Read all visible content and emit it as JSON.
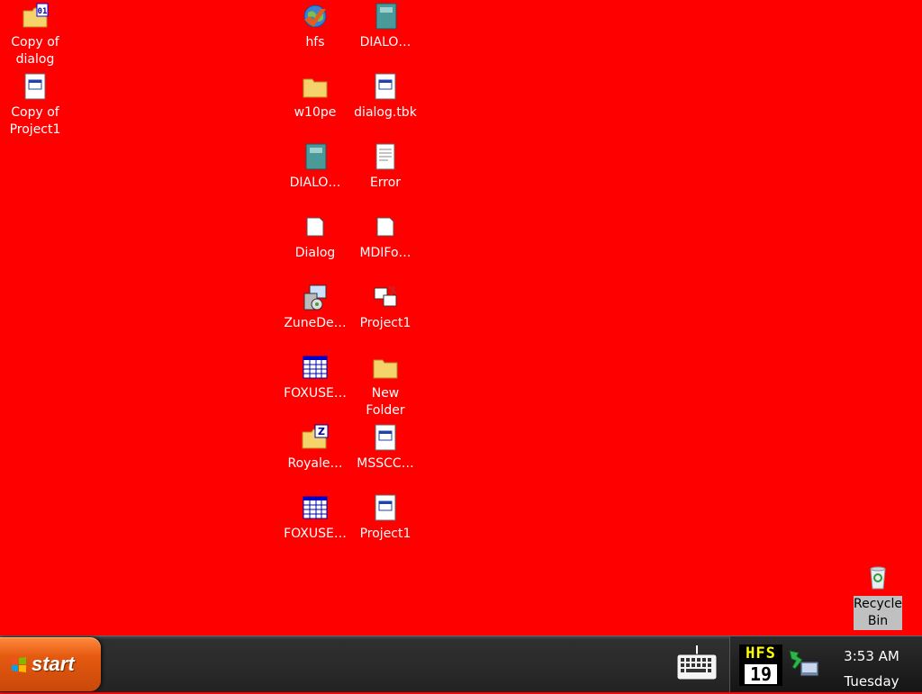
{
  "desktop": {
    "icons": {
      "copy_of_dialog": "Copy of dialog",
      "copy_of_project1": "Copy of Project1",
      "hfs": "hfs",
      "dialo1": "DIALO…",
      "w10pe": "w10pe",
      "dialog_tbk": "dialog.tbk",
      "dialo2": "DIALO…",
      "error": "Error",
      "dialog": "Dialog",
      "mdifo": "MDIFo…",
      "zunede": "ZuneDe…",
      "project1_a": "Project1",
      "foxuse1": "FOXUSE…",
      "new_folder": "New Folder",
      "royale": "Royale…",
      "msscc": "MSSCC…",
      "foxuse2": "FOXUSE…",
      "project1_b": "Project1",
      "recycle_bin": "Recycle Bin"
    },
    "background_color": "#ff0000"
  },
  "taskbar": {
    "start_label": "start",
    "tray": {
      "hfs_top": "HFS",
      "hfs_bottom": "19",
      "time": "3:53 AM",
      "day": "Tuesday"
    }
  }
}
